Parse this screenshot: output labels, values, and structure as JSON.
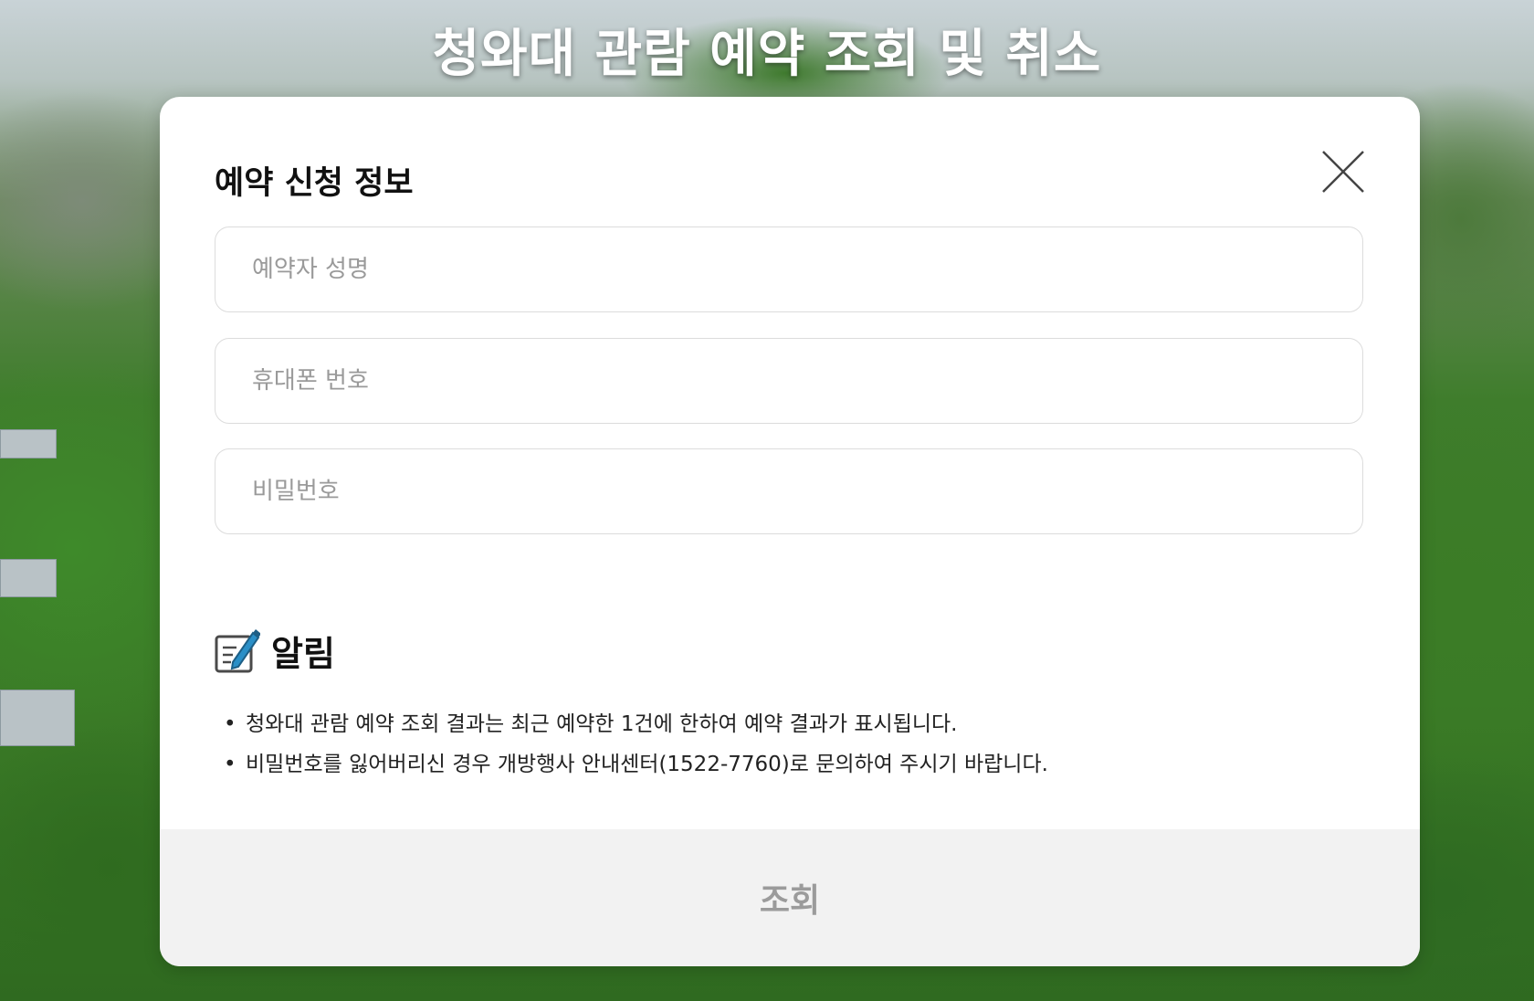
{
  "page": {
    "title": "청와대 관람 예약 조회 및 취소"
  },
  "modal": {
    "heading": "예약 신청 정보",
    "close_icon": "close-icon",
    "fields": {
      "name": {
        "placeholder": "예약자 성명",
        "value": ""
      },
      "phone": {
        "placeholder": "휴대폰 번호",
        "value": ""
      },
      "password": {
        "placeholder": "비밀번호",
        "value": ""
      }
    },
    "notice": {
      "icon": "memo-pencil-icon",
      "title": "알림",
      "items": [
        "청와대 관람 예약 조회 결과는 최근 예약한 1건에 한하여 예약 결과가 표시됩니다.",
        "비밀번호를 잃어버리신 경우 개방행사 안내센터(1522-7760)로 문의하여 주시기 바랍니다."
      ]
    },
    "submit_label": "조회"
  },
  "colors": {
    "submit_bar_bg": "#f2f2f2",
    "submit_text": "#9b9b9b",
    "field_border": "#dcdcdc",
    "icon_accent": "#2a8fc7"
  }
}
